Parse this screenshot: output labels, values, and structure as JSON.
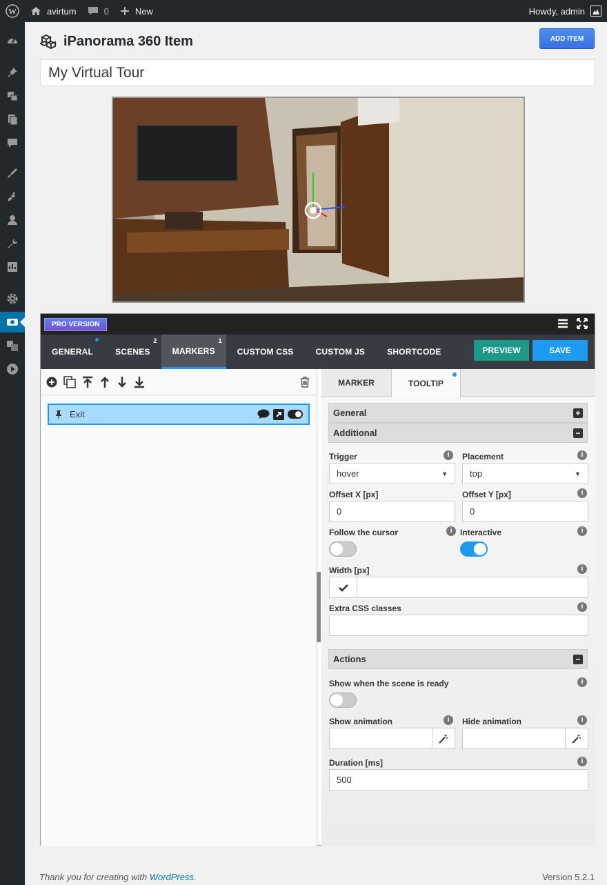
{
  "adminbar": {
    "site_name": "avirtum",
    "comments_count": "0",
    "new_label": "New",
    "howdy": "Howdy, admin"
  },
  "header": {
    "title": "iPanorama 360 Item",
    "add_item_label": "ADD ITEM",
    "item_title_value": "My Virtual Tour"
  },
  "builder": {
    "pro_label": "PRO VERSION",
    "tabs": [
      {
        "label": "GENERAL",
        "badge": ""
      },
      {
        "label": "SCENES",
        "badge": "2"
      },
      {
        "label": "MARKERS",
        "badge": "1"
      },
      {
        "label": "CUSTOM CSS",
        "badge": ""
      },
      {
        "label": "CUSTOM JS",
        "badge": ""
      },
      {
        "label": "SHORTCODE",
        "badge": ""
      }
    ],
    "preview_label": "PREVIEW",
    "save_label": "SAVE"
  },
  "markers": {
    "items": [
      {
        "label": "Exit"
      }
    ]
  },
  "right_tabs": {
    "marker": "MARKER",
    "tooltip": "TOOLTIP"
  },
  "sections": {
    "general": "General",
    "additional": "Additional",
    "actions": "Actions"
  },
  "fields": {
    "trigger_label": "Trigger",
    "trigger_value": "hover",
    "placement_label": "Placement",
    "placement_value": "top",
    "offset_x_label": "Offset X [px]",
    "offset_x_value": "0",
    "offset_y_label": "Offset Y [px]",
    "offset_y_value": "0",
    "follow_cursor_label": "Follow the cursor",
    "follow_cursor_on": false,
    "interactive_label": "Interactive",
    "interactive_on": true,
    "width_label": "Width [px]",
    "width_value": "",
    "extra_css_label": "Extra CSS classes",
    "extra_css_value": "",
    "show_ready_label": "Show when the scene is ready",
    "show_ready_on": false,
    "show_anim_label": "Show animation",
    "hide_anim_label": "Hide animation",
    "duration_label": "Duration [ms]",
    "duration_value": "500"
  },
  "footer": {
    "thanks_prefix": "Thank you for creating with ",
    "link": "WordPress",
    "suffix": ".",
    "version": "Version 5.2.1"
  }
}
